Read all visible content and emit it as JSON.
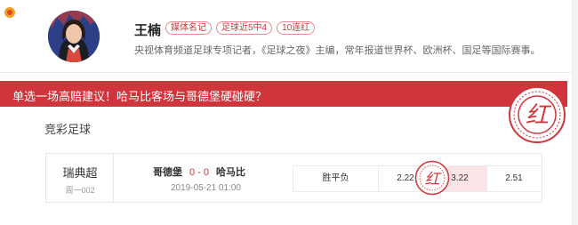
{
  "author": {
    "name": "王楠",
    "badges": [
      "媒体名记",
      "足球近5中4",
      "10连红"
    ],
    "bio": "央视体育频道足球专项记者，《足球之夜》主编，常年报道世界杯、欧洲杯、国足等国际赛事。"
  },
  "banner": {
    "title": "单选一场高赔建议！哈马比客场与哥德堡硬碰硬？",
    "color": "#d0353b"
  },
  "stamps": {
    "text": "红"
  },
  "section": {
    "title": "竞彩足球"
  },
  "match": {
    "league": "瑞典超",
    "number": "周一002",
    "home": "哥德堡",
    "score": "0 - 0",
    "away": "哈马比",
    "time": "2019-05-21 01:00",
    "bet_type": "胜平负",
    "odds": [
      "2.22",
      "3.22",
      "2.51"
    ],
    "highlighted_index": 1
  }
}
